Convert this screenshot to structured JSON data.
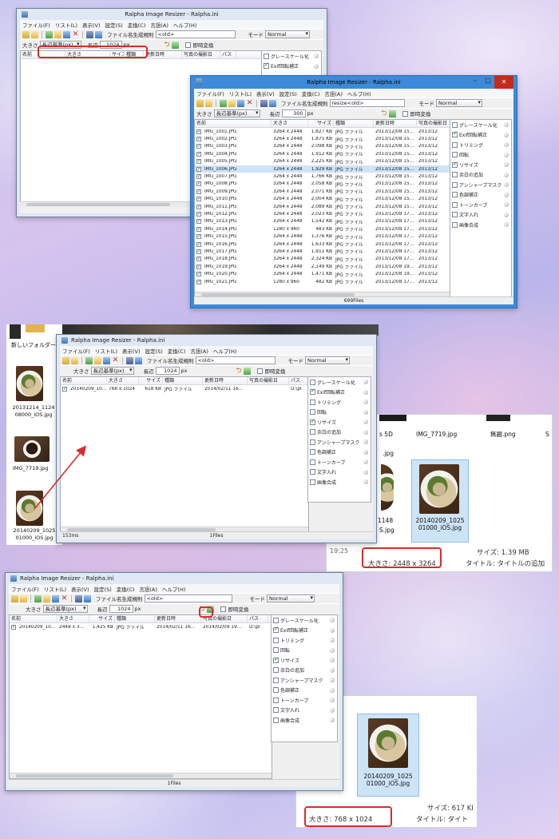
{
  "app_title": "Ralpha Image Resizer - Ralpha.ini",
  "menu": [
    "ファイル(F)",
    "リスト(L)",
    "表示(V)",
    "設定(S)",
    "変換(C)",
    "言語(A)",
    "ヘルプ(H)"
  ],
  "toolbar": {
    "rule_label": "ファイル名生成規則",
    "rule_value": "<old>",
    "rule_value_win2": "resize<old>",
    "mode_label": "モード",
    "mode_value": "Normal",
    "size_label": "大きさ",
    "size_value": "長辺基準(px)",
    "edge_label": "長辺",
    "edge_value": "1024",
    "edge_value_win2": "300",
    "unit": "px",
    "instant_label": "即時変換"
  },
  "columns": [
    "名前",
    "大きさ",
    "サイズ",
    "種類",
    "更新日時",
    "写真の撮影日",
    "パス"
  ],
  "options": [
    {
      "label": "グレースケール化",
      "checked": false
    },
    {
      "label": "Exif回転補正",
      "checked": true
    },
    {
      "label": "トリミング",
      "checked": false
    },
    {
      "label": "回転",
      "checked": false
    },
    {
      "label": "リサイズ",
      "checked": true
    },
    {
      "label": "余白の追加",
      "checked": false
    },
    {
      "label": "アンシャープマスク",
      "checked": false
    },
    {
      "label": "色調補正",
      "checked": false
    },
    {
      "label": "トーンカーブ",
      "checked": false
    },
    {
      "label": "文字入れ",
      "checked": false
    },
    {
      "label": "画像合成",
      "checked": false
    }
  ],
  "win2_files": [
    {
      "name": "IMG_1001.JPG",
      "dim": "3264 x 2448",
      "size": "1,827 KB",
      "type": "JPG ファイル",
      "date": "2013/12/08 15...",
      "shot": "2013/12"
    },
    {
      "name": "IMG_1002.JPG",
      "dim": "3264 x 2448",
      "size": "1,875 KB",
      "type": "JPG ファイル",
      "date": "2013/12/08 15...",
      "shot": "2013/12"
    },
    {
      "name": "IMG_1003.JPG",
      "dim": "3264 x 2448",
      "size": "2,098 KB",
      "type": "JPG ファイル",
      "date": "2013/12/08 15...",
      "shot": "2013/12"
    },
    {
      "name": "IMG_1004.JPG",
      "dim": "3264 x 2448",
      "size": "1,912 KB",
      "type": "JPG ファイル",
      "date": "2013/12/08 15...",
      "shot": "2013/12"
    },
    {
      "name": "IMG_1005.JPG",
      "dim": "3264 x 2448",
      "size": "2,225 KB",
      "type": "JPG ファイル",
      "date": "2013/12/08 15...",
      "shot": "2013/12"
    },
    {
      "name": "IMG_1006.JPG",
      "dim": "3264 x 2448",
      "size": "1,929 KB",
      "type": "JPG ファイル",
      "date": "2013/12/08 15...",
      "shot": "2013/12",
      "selected": true
    },
    {
      "name": "IMG_1007.JPG",
      "dim": "3264 x 2448",
      "size": "1,766 KB",
      "type": "JPG ファイル",
      "date": "2013/12/08 15...",
      "shot": "2013/12"
    },
    {
      "name": "IMG_1008.JPG",
      "dim": "3264 x 2448",
      "size": "2,058 KB",
      "type": "JPG ファイル",
      "date": "2013/12/08 15...",
      "shot": "2013/12"
    },
    {
      "name": "IMG_1009.JPG",
      "dim": "3264 x 2448",
      "size": "2,071 KB",
      "type": "JPG ファイル",
      "date": "2013/12/08 15...",
      "shot": "2013/12"
    },
    {
      "name": "IMG_1010.JPG",
      "dim": "3264 x 2448",
      "size": "2,004 KB",
      "type": "JPG ファイル",
      "date": "2013/12/08 15...",
      "shot": "2013/12"
    },
    {
      "name": "IMG_1011.JPG",
      "dim": "3264 x 2448",
      "size": "2,089 KB",
      "type": "JPG ファイル",
      "date": "2013/12/08 15...",
      "shot": "2013/12"
    },
    {
      "name": "IMG_1012.JPG",
      "dim": "3264 x 2448",
      "size": "2,023 KB",
      "type": "JPG ファイル",
      "date": "2013/12/08 17...",
      "shot": "2013/12"
    },
    {
      "name": "IMG_1013.JPG",
      "dim": "3264 x 2448",
      "size": "1,542 KB",
      "type": "JPG ファイル",
      "date": "2013/12/08 17...",
      "shot": "2013/12"
    },
    {
      "name": "IMG_1014.JPG",
      "dim": "1280 x 960",
      "size": "483 KB",
      "type": "JPG ファイル",
      "date": "2013/12/08 17...",
      "shot": "2013/12"
    },
    {
      "name": "IMG_1015.JPG",
      "dim": "3264 x 2448",
      "size": "1,376 KB",
      "type": "JPG ファイル",
      "date": "2013/12/08 17...",
      "shot": "2013/12"
    },
    {
      "name": "IMG_1016.JPG",
      "dim": "3264 x 2448",
      "size": "1,633 KB",
      "type": "JPG ファイル",
      "date": "2013/12/08 17...",
      "shot": "2013/12"
    },
    {
      "name": "IMG_1017.JPG",
      "dim": "3264 x 2448",
      "size": "1,911 KB",
      "type": "JPG ファイル",
      "date": "2013/12/08 17...",
      "shot": "2013/12"
    },
    {
      "name": "IMG_1018.JPG",
      "dim": "3264 x 2448",
      "size": "2,324 KB",
      "type": "JPG ファイル",
      "date": "2013/12/08 17...",
      "shot": "2013/12"
    },
    {
      "name": "IMG_1019.JPG",
      "dim": "3264 x 2448",
      "size": "2,149 KB",
      "type": "JPG ファイル",
      "date": "2013/12/08 19...",
      "shot": "2013/12"
    },
    {
      "name": "IMG_1020.JPG",
      "dim": "3264 x 2448",
      "size": "1,471 KB",
      "type": "JPG ファイル",
      "date": "2013/12/08 19...",
      "shot": "2013/12"
    },
    {
      "name": "IMG_1021.JPG",
      "dim": "1280 x 960",
      "size": "482 KB",
      "type": "JPG ファイル",
      "date": "2013/12/08 17...",
      "shot": "2013/12"
    }
  ],
  "win2_status": "699Files",
  "win3_file": {
    "name": "20140209_10...",
    "dim": "768 x 1024",
    "size": "618 KB",
    "type": "JPG ファイル",
    "date": "2014/02/11 16...",
    "shot": "",
    "path": "D:\\pi"
  },
  "win3_status_left": "153ms",
  "win3_status": "1Files",
  "win4_file": {
    "name": "20140209_10...",
    "dim": "2448 x 3...",
    "size": "1,425 KB",
    "type": "JPG ファイル",
    "date": "2014/02/11 16...",
    "shot": "2014/02/09 19...",
    "path": "D:\\pi"
  },
  "win4_status": "1Files",
  "explorer_left": {
    "new_folder": "新しいフォルダー",
    "item1": "20131214_1124 08000_iOS.jpg",
    "item2": "IMG_7719.jpg",
    "item3": "20140209_1025 01000_iOS.jpg"
  },
  "explorer_mid": {
    "top1": "s 5D",
    "top2": "IMG_7719.jpg",
    "top3": "無題.png",
    "top4": "S",
    "left_frag1": ".jpg",
    "left_frag2": "1148",
    "left_frag3": "S.jpg",
    "selected_name": "20140209_1025 01000_iOS.jpg",
    "time": "19:25",
    "dim_text": "大きさ: 2448 x 3264",
    "size_text": "サイズ: 1.39 MB",
    "title_text": "タイトル: タイトルの追加"
  },
  "explorer_bottom": {
    "name": "20140209_1025 01000_iOS.jpg",
    "dim_text": "大きさ: 768 x 1024",
    "size_text": "サイズ: 617 KI",
    "title_text": "タイトル: タイト"
  },
  "colors": {
    "highlight": "#d72d2d",
    "titlebar_w8": "#3c8ad8",
    "selection": "#cfe3f8"
  }
}
